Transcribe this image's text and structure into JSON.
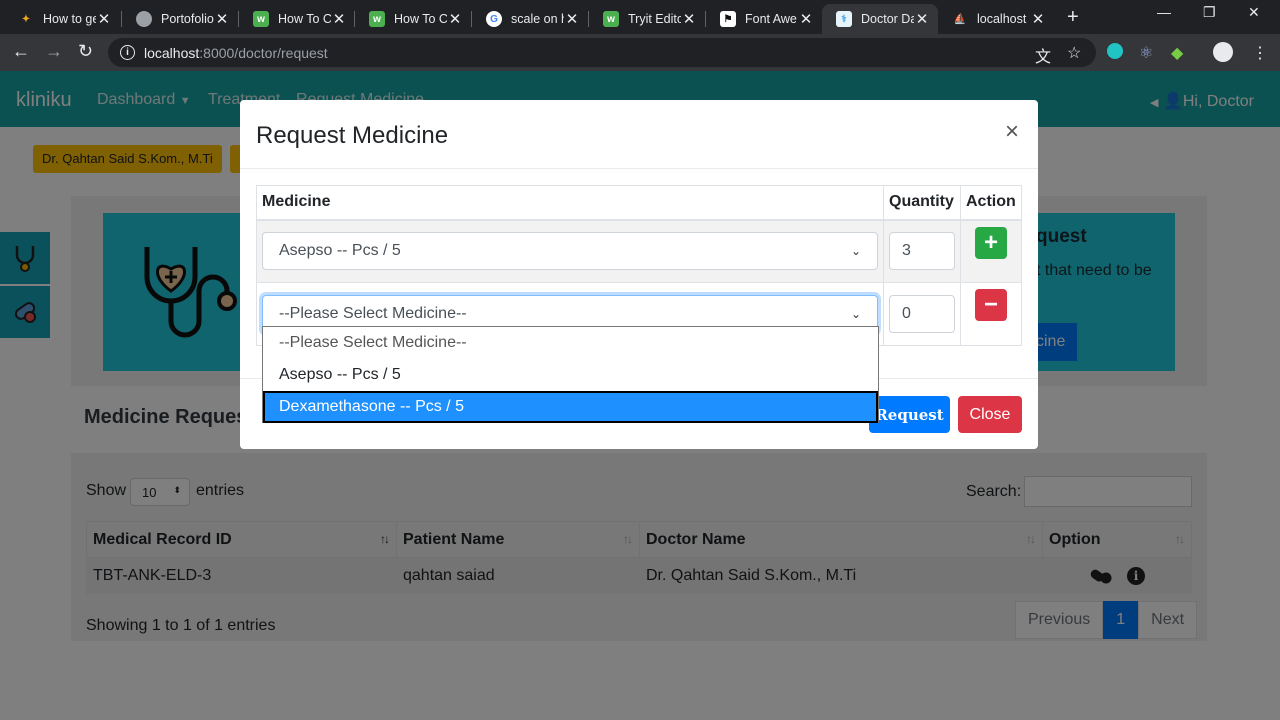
{
  "browser": {
    "tabs": [
      {
        "title": "How to ge",
        "favicon": "sparkle-icon",
        "color": "#f5a623"
      },
      {
        "title": "Portofolio",
        "favicon": "globe-icon",
        "color": "#9aa0a6"
      },
      {
        "title": "How To C",
        "favicon": "w3-icon",
        "color": "#4caf50"
      },
      {
        "title": "How To C",
        "favicon": "w3-icon",
        "color": "#4caf50"
      },
      {
        "title": "scale on h",
        "favicon": "google-icon",
        "color": "#4285f4"
      },
      {
        "title": "Tryit Edito",
        "favicon": "w3-icon",
        "color": "#4caf50"
      },
      {
        "title": "Font Awe",
        "favicon": "flag-icon",
        "color": "#111111"
      },
      {
        "title": "Doctor Da",
        "favicon": "doctor-icon",
        "color": "#4aa3df"
      },
      {
        "title": "localhost",
        "favicon": "phpmyadmin-icon",
        "color": "#f0a030"
      }
    ],
    "url_host": "localhost",
    "url_path": ":8000/doctor/request"
  },
  "app": {
    "brand": "kliniku",
    "nav": [
      "Dashboard",
      "Treatment",
      "Request Medicine"
    ],
    "user": "Hi, Doctor",
    "doctor_badge": "Dr. Qahtan Said S.Kom., M.Ti",
    "hero_title": "quest",
    "hero_text": "t that need to be",
    "hero_button": "cine",
    "section_title": "Medicine Request",
    "show_label": "Show",
    "entries_value": "10",
    "entries_label": "entries",
    "search_label": "Search:",
    "table": {
      "headers": [
        "Medical Record ID",
        "Patient Name",
        "Doctor Name",
        "Option"
      ],
      "rows": [
        {
          "record_id": "TBT-ANK-ELD-3",
          "patient": "qahtan saiad",
          "doctor": "Dr. Qahtan Said S.Kom., M.Ti"
        }
      ]
    },
    "info_text": "Showing 1 to 1 of 1 entries",
    "pagination": {
      "previous": "Previous",
      "current": "1",
      "next": "Next"
    }
  },
  "modal": {
    "title": "Request Medicine",
    "close_symbol": "×",
    "headers": {
      "medicine": "Medicine",
      "quantity": "Quantity",
      "action": "Action"
    },
    "rows": [
      {
        "medicine": "Asepso -- Pcs / 5",
        "quantity": "3",
        "action_symbol": "+"
      },
      {
        "medicine": "--Please Select Medicine--",
        "quantity": "0",
        "action_symbol": "−"
      }
    ],
    "dropdown_options": [
      "--Please Select Medicine--",
      "Asepso -- Pcs / 5",
      "Dexamethasone -- Pcs / 5"
    ],
    "highlighted_option": "Dexamethasone -- Pcs / 5",
    "request_button": "Request",
    "close_button": "Close"
  },
  "colors": {
    "navbar": "#17a2a2",
    "primary": "#007bff",
    "success": "#28a745",
    "danger": "#dc3545",
    "warning": "#ffc107",
    "highlight": "#1e90ff"
  }
}
